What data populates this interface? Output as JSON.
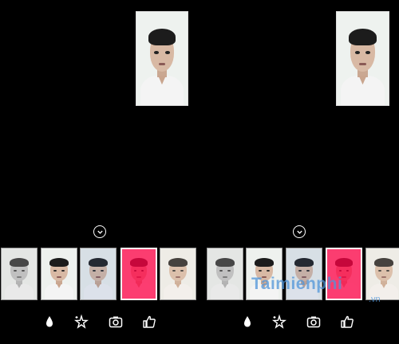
{
  "panels": [
    {
      "name": "left",
      "filters": [
        {
          "tint": "rgba(200,200,200,0.25)",
          "grayscale": true
        },
        {
          "tint": "rgba(255,255,255,0)",
          "grayscale": false
        },
        {
          "tint": "rgba(90,120,180,0.15)",
          "grayscale": false
        },
        {
          "tint": "rgba(255,0,70,0.75)",
          "grayscale": false
        },
        {
          "tint": "rgba(240,220,200,0.2)",
          "grayscale": false
        }
      ]
    },
    {
      "name": "right",
      "filters": [
        {
          "tint": "rgba(200,200,200,0.25)",
          "grayscale": true
        },
        {
          "tint": "rgba(255,255,255,0)",
          "grayscale": false
        },
        {
          "tint": "rgba(90,120,180,0.15)",
          "grayscale": false
        },
        {
          "tint": "rgba(255,0,70,0.75)",
          "grayscale": false
        },
        {
          "tint": "rgba(240,220,200,0.2)",
          "grayscale": false
        }
      ]
    }
  ],
  "icons": [
    "drop-icon",
    "sparkle-icon",
    "camera-icon",
    "thumbs-up-icon"
  ],
  "watermark": {
    "text": "Taimienphi",
    "sub": ".vn"
  },
  "colors": {
    "background": "#000000",
    "accent_red": "#ff2d55",
    "watermark": "#4f94d8"
  }
}
